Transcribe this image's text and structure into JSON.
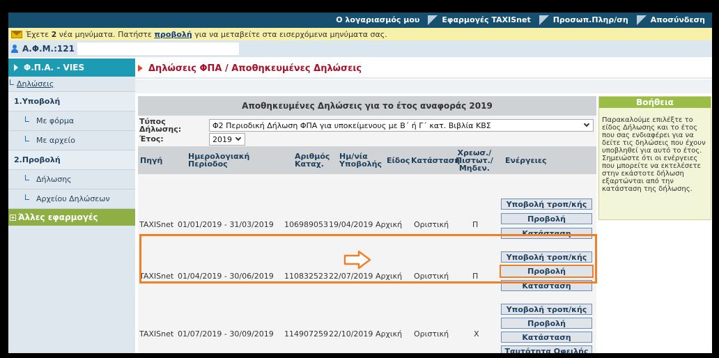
{
  "topnav": {
    "items": [
      "Ο λογαριασμός μου",
      "Εφαρμογές TAXISnet",
      "Προσωπ.Πληρ/ση",
      "Αποσύνδεση"
    ]
  },
  "messages": {
    "prefix": "Έχετε",
    "count": "2",
    "middle": "νέα μηνύματα. Πατήστε",
    "link": "προβολή",
    "suffix": "για να μεταβείτε στα εισερχόμενα μηνύματα σας."
  },
  "afm": {
    "label": "Α.Φ.Μ.:121",
    "value": ""
  },
  "sidebar": {
    "section_title": "Φ.Π.Α. - VIES",
    "declarations": "Δηλώσεις",
    "submit": "1.Υποβολή",
    "with_form": "Με φόρμα",
    "with_file": "Με αρχείο",
    "view": "2.Προβολή",
    "view_declaration": "Δήλωσης",
    "view_file": "Αρχείου Δηλώσεων",
    "other_apps": "Άλλες εφαρμογές"
  },
  "breadcrumb": "Δηλώσεις ΦΠΑ / Αποθηκευμένες Δηλώσεις",
  "panel": {
    "title": "Αποθηκευμένες Δηλώσεις για το έτος αναφοράς 2019",
    "type_label_1": "Τύπος",
    "type_label_2": "Δήλωσης:",
    "type_value": "Φ2 Περιοδική Δήλωση ΦΠΑ για υποκείμενους με Β΄ ή Γ΄ κατ. Βιβλία ΚΒΣ",
    "year_label": "Έτος:",
    "year_value": "2019"
  },
  "columns": {
    "source": "Πηγή",
    "period_1": "Ημερολογιακή",
    "period_2": "Περίοδος",
    "regno_1": "Αριθμός",
    "regno_2": "Καταχ.",
    "date_1": "Ημ/νία",
    "date_2": "Υποβολής",
    "kind": "Είδος",
    "status": "Κατάσταση",
    "debit_1": "Χρεωσ./",
    "debit_2": "Πιστωτ./",
    "debit_3": "Μηδεν.",
    "actions": "Ενέργειες"
  },
  "rows": [
    {
      "source": "TAXISnet",
      "period": "01/01/2019 - 31/03/2019",
      "regno": "106989053",
      "date": "19/04/2019",
      "kind": "Αρχική",
      "status": "Οριστική",
      "debit": "Π",
      "actions": [
        "Υποβολή τροπ/κής",
        "Προβολή",
        "Κατάσταση"
      ]
    },
    {
      "source": "TAXISnet",
      "period": "01/04/2019 - 30/06/2019",
      "regno": "110832523",
      "date": "22/07/2019",
      "kind": "Αρχική",
      "status": "Οριστική",
      "debit": "Π",
      "actions": [
        "Υποβολή τροπ/κής",
        "Προβολή",
        "Κατάσταση"
      ]
    },
    {
      "source": "TAXISnet",
      "period": "01/07/2019 - 30/09/2019",
      "regno": "114907259",
      "date": "22/10/2019",
      "kind": "Αρχική",
      "status": "Οριστική",
      "debit": "Χ",
      "actions": [
        "Υποβολή τροπ/κής",
        "Προβολή",
        "Κατάσταση",
        "Ταυτότητα Οφειλής"
      ]
    }
  ],
  "help": {
    "title": "Βοήθεια",
    "text": "Παρακαλούμε επιλέξτε το είδος Δήλωσης και το έτος που σας ενδιαφέρει για να δείτε τις δηλώσεις που έχουν υποβληθεί για αυτό το έτος. Σημειώστε ότι οι ενέργειες που μπορείτε να εκτελέσετε στην εκάστοτε δήλωση εξαρτώνται από την κατάσταση της δήλωσης."
  },
  "colors": {
    "nav": "#17506f",
    "accent": "#1d9bb3",
    "highlight": "#f07f2a",
    "breadcrumb": "#a8102a",
    "other_apps": "#8faf44"
  }
}
